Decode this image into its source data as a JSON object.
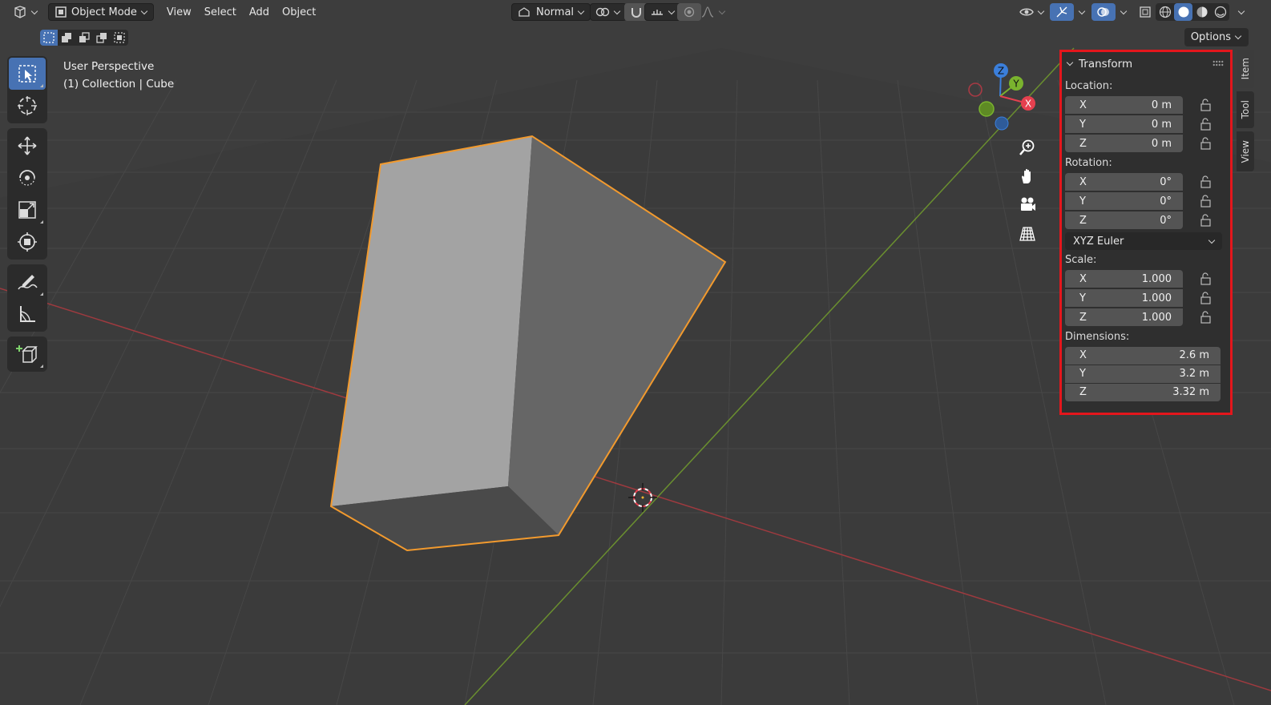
{
  "header": {
    "editor_type_icon": "editor-type-icon",
    "mode_label": "Object Mode",
    "menus": [
      "View",
      "Select",
      "Add",
      "Object"
    ],
    "orientation_label": "Normal",
    "options_label": "Options"
  },
  "viewport": {
    "perspective_label": "User Perspective",
    "collection_label": "(1) Collection | Cube"
  },
  "gizmo": {
    "x": "X",
    "y": "Y",
    "z": "Z"
  },
  "transform_panel": {
    "title": "Transform",
    "location_label": "Location:",
    "location": [
      {
        "axis": "X",
        "value": "0 m"
      },
      {
        "axis": "Y",
        "value": "0 m"
      },
      {
        "axis": "Z",
        "value": "0 m"
      }
    ],
    "rotation_label": "Rotation:",
    "rotation": [
      {
        "axis": "X",
        "value": "0°"
      },
      {
        "axis": "Y",
        "value": "0°"
      },
      {
        "axis": "Z",
        "value": "0°"
      }
    ],
    "rotation_mode": "XYZ Euler",
    "scale_label": "Scale:",
    "scale": [
      {
        "axis": "X",
        "value": "1.000"
      },
      {
        "axis": "Y",
        "value": "1.000"
      },
      {
        "axis": "Z",
        "value": "1.000"
      }
    ],
    "dimensions_label": "Dimensions:",
    "dimensions": [
      {
        "axis": "X",
        "value": "2.6 m"
      },
      {
        "axis": "Y",
        "value": "3.2 m"
      },
      {
        "axis": "Z",
        "value": "3.32 m"
      }
    ]
  },
  "side_tabs": [
    "Item",
    "Tool",
    "View"
  ],
  "colors": {
    "accent": "#4772b3",
    "selection_outline": "#f29a2e",
    "highlight_box": "#e4161c",
    "x_axis": "#e5404f",
    "y_axis": "#7ab32e",
    "z_axis": "#3b7fdb"
  }
}
